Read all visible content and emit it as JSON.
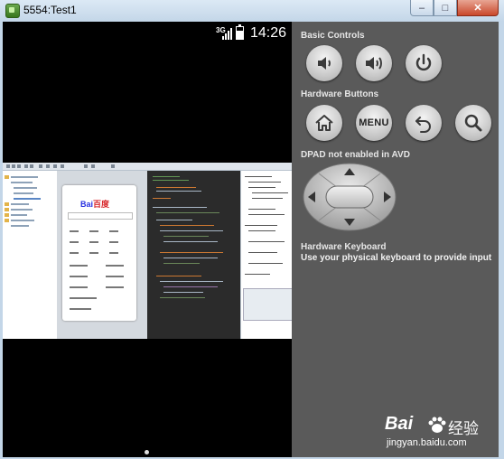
{
  "window": {
    "title": "5554:Test1",
    "minimize_symbol": "–",
    "maximize_symbol": "□",
    "close_symbol": "✕"
  },
  "status_bar": {
    "network_label": "3G",
    "time": "14:26",
    "signal_icon": "signal-bars-icon",
    "battery_icon": "battery-icon"
  },
  "embedded_screenshot": {
    "description_icon": "eclipse-ide-screenshot",
    "logo_text_left": "Bai",
    "logo_text_right": "百度"
  },
  "controls": {
    "basic_controls": {
      "heading": "Basic Controls",
      "buttons": [
        {
          "icon": "volume-down-icon"
        },
        {
          "icon": "volume-up-icon"
        },
        {
          "icon": "power-icon"
        }
      ]
    },
    "hardware_buttons": {
      "heading": "Hardware Buttons",
      "home_icon": "home-icon",
      "menu_label": "MENU",
      "back_icon": "back-icon",
      "search_icon": "search-icon"
    },
    "dpad": {
      "heading": "DPAD not enabled in AVD",
      "icon": "dpad-icon"
    },
    "keyboard": {
      "heading": "Hardware Keyboard",
      "note": "Use your physical keyboard to provide input"
    }
  },
  "watermark": {
    "logo": "Bai",
    "cn": "经验",
    "url": "jingyan.baidu.com"
  },
  "colors": {
    "panel_bg": "#5a5a5a",
    "screen_bg": "#000000",
    "frame": "#c3d6e8"
  }
}
